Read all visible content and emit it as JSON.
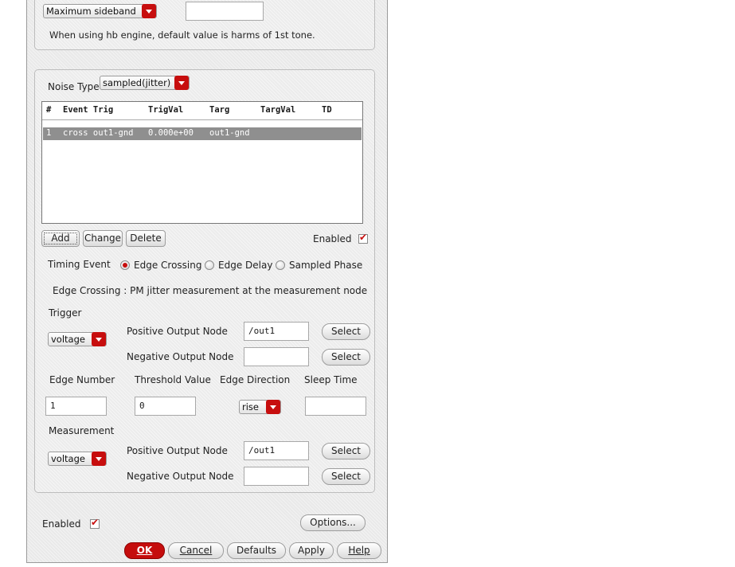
{
  "sideband": {
    "value": "Maximum sideband",
    "extra_value": "",
    "note": "When using hb engine, default value is harms of 1st tone."
  },
  "noise": {
    "type_label": "Noise Type",
    "type_value": "sampled(jitter)",
    "table": {
      "headers": [
        "#",
        "Event Trig",
        "TrigVal",
        "Targ",
        "TargVal",
        "TD"
      ],
      "rows": [
        {
          "num": "1",
          "event_trig": "cross out1-gnd",
          "trig_val": "0.000e+00",
          "targ": "out1-gnd",
          "targ_val": "",
          "td": ""
        }
      ]
    },
    "add_label": "Add",
    "change_label": "Change",
    "delete_label": "Delete",
    "enabled_label": "Enabled",
    "enabled": true
  },
  "timing": {
    "label": "Timing Event",
    "options": [
      "Edge Crossing",
      "Edge Delay",
      "Sampled Phase"
    ],
    "selected": "Edge Crossing",
    "description": "Edge Crossing : PM jitter measurement at the measurement node"
  },
  "trigger": {
    "heading": "Trigger",
    "type": "voltage",
    "pos_label": "Positive Output Node",
    "pos_value": "/out1",
    "neg_label": "Negative Output Node",
    "neg_value": "",
    "select_label": "Select"
  },
  "edge": {
    "number_label": "Edge Number",
    "number_value": "1",
    "threshold_label": "Threshold Value",
    "threshold_value": "0",
    "direction_label": "Edge Direction",
    "direction_value": "rise",
    "sleep_label": "Sleep Time",
    "sleep_value": ""
  },
  "measurement": {
    "heading": "Measurement",
    "type": "voltage",
    "pos_label": "Positive Output Node",
    "pos_value": "/out1",
    "neg_label": "Negative Output Node",
    "neg_value": "",
    "select_label": "Select"
  },
  "footer": {
    "enabled_label": "Enabled",
    "enabled": true,
    "options_label": "Options...",
    "ok_label": "OK",
    "cancel_label": "Cancel",
    "defaults_label": "Defaults",
    "apply_label": "Apply",
    "help_label": "Help"
  },
  "colors": {
    "accent": "#c70e0e",
    "selection": "#8f8f8f",
    "panel": "#e9e9e9"
  }
}
